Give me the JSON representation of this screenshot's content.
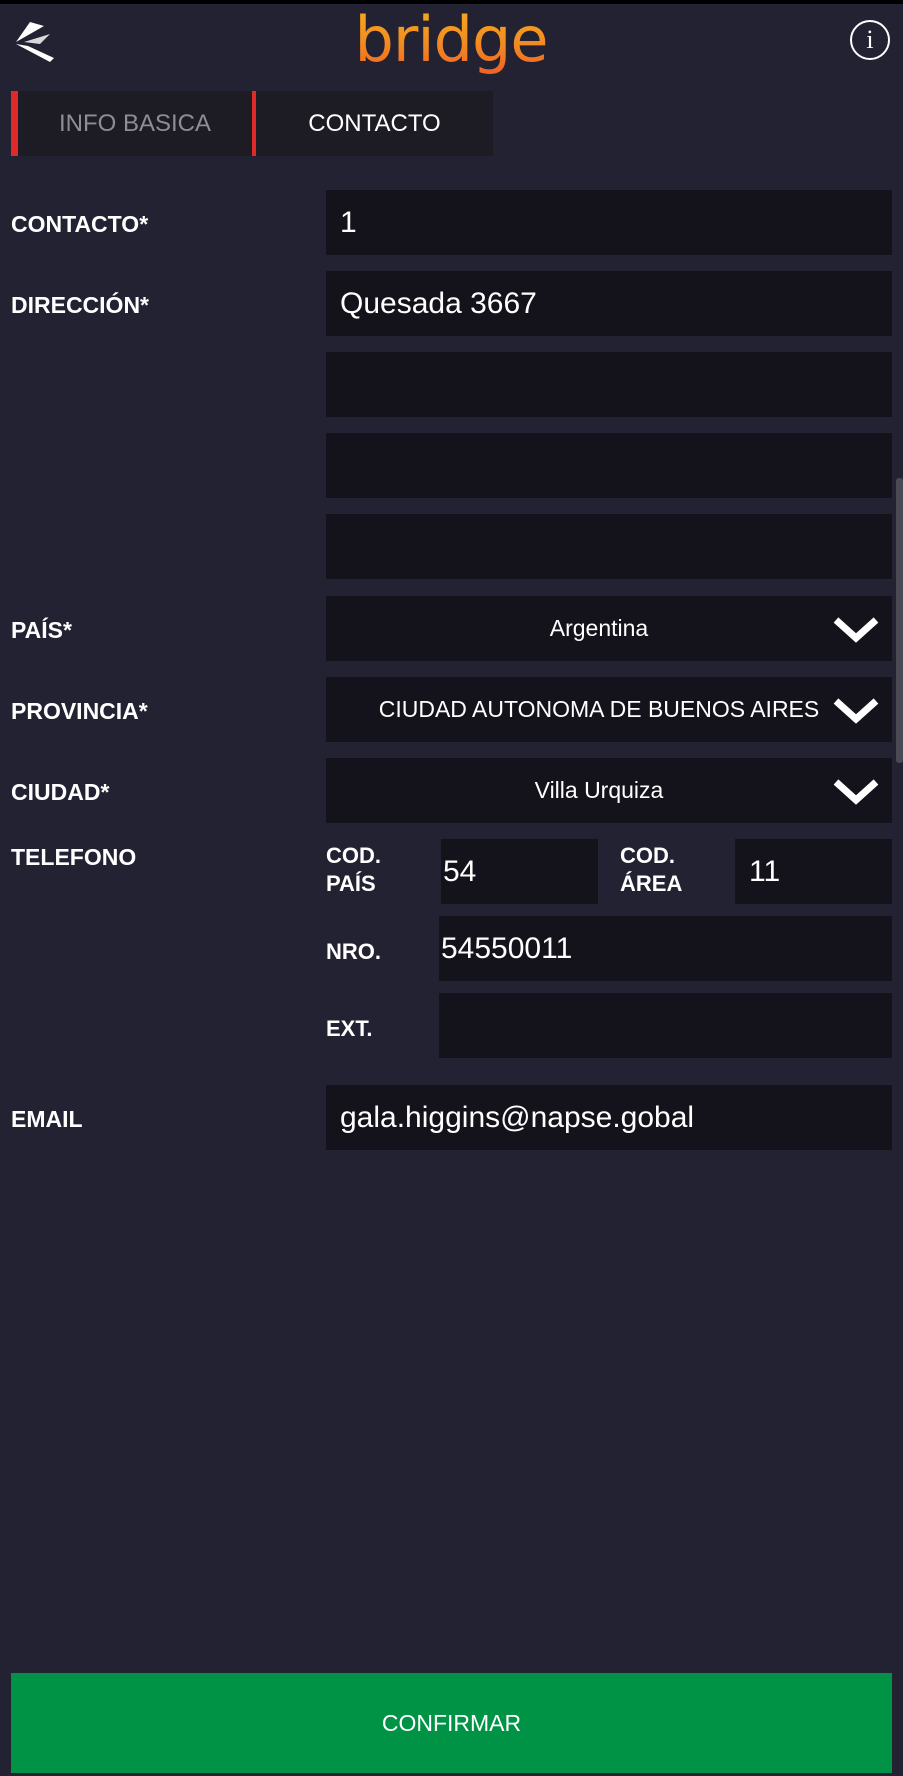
{
  "header": {
    "logo_text": "bridge",
    "back_icon": "back-arrow-icon",
    "info_icon": "info-icon",
    "info_glyph": "i"
  },
  "tabs": [
    {
      "label": "INFO BASICA",
      "active": false
    },
    {
      "label": "CONTACTO",
      "active": true
    }
  ],
  "form": {
    "contacto": {
      "label": "CONTACTO*",
      "value": "1"
    },
    "direccion": {
      "label": "DIRECCIÓN*",
      "lines": [
        "Quesada 3667",
        "",
        "",
        ""
      ]
    },
    "pais": {
      "label": "PAÍS*",
      "value": "Argentina"
    },
    "provincia": {
      "label": "PROVINCIA*",
      "value": "CIUDAD AUTONOMA DE BUENOS AIRES"
    },
    "ciudad": {
      "label": "CIUDAD*",
      "value": "Villa Urquiza"
    },
    "telefono": {
      "label": "TELEFONO",
      "cod_pais_label_1": "COD.",
      "cod_pais_label_2": "PAÍS",
      "cod_pais": "54",
      "cod_area_label_1": "COD.",
      "cod_area_label_2": "ÁREA",
      "cod_area": "11",
      "nro_label": "NRO.",
      "nro": "54550011",
      "ext_label": "EXT.",
      "ext": ""
    },
    "email": {
      "label": "EMAIL",
      "value": "gala.higgins@napse.gobal"
    }
  },
  "confirm_label": "CONFIRMAR",
  "colors": {
    "background": "#232233",
    "field": "#14131b",
    "accent_red": "#e02a2a",
    "confirm_green": "#009345",
    "logo_orange": "#f28a22"
  }
}
